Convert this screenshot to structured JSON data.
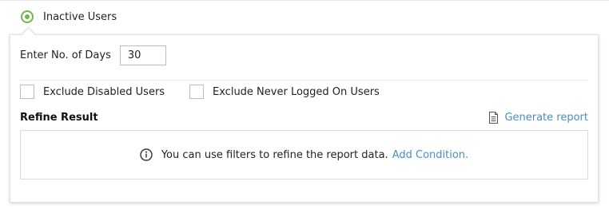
{
  "report_option": {
    "label": "Inactive Users",
    "selected": true
  },
  "days": {
    "label": "Enter No. of Days",
    "value": "30"
  },
  "options": [
    {
      "label": "Exclude Disabled Users",
      "checked": false
    },
    {
      "label": "Exclude Never Logged On Users",
      "checked": false
    }
  ],
  "refine": {
    "title": "Refine Result",
    "generate_label": "Generate report",
    "hint": "You can use filters to refine the report data.",
    "add_condition": "Add Condition."
  },
  "colors": {
    "accent_green": "#6fb94a",
    "link_blue": "#4a8fc2"
  },
  "icons": {
    "radio": "radio-selected-icon",
    "generate": "document-icon",
    "hint": "info-icon"
  }
}
